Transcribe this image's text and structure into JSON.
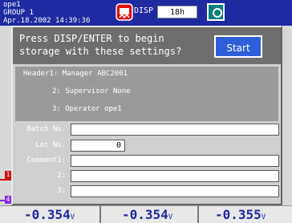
{
  "header": {
    "line1": "ope1",
    "line2": "GROUP 1",
    "line3": "Apr.18.2002 14:39:36",
    "disp_label": "DISP",
    "disp_value": "18h",
    "disp_icon": "disp-icon",
    "media_icon": "media-icon"
  },
  "dialog": {
    "prompt_line1": "Press DISP/ENTER to begin",
    "prompt_line2": "storage with these settings?",
    "start_label": "Start",
    "header1": "Header1: Manager ABC2001",
    "header2": "2: Supervisor None",
    "header3": "3: Operator ope1",
    "fields": {
      "batch_label": "Batch No.",
      "batch_value": "",
      "lot_label": "Lot No.",
      "lot_value": "0",
      "comment1_label": "Comment1:",
      "comment1_value": "",
      "comment2_label": "2:",
      "comment2_value": "",
      "comment3_label": "3:",
      "comment3_value": ""
    }
  },
  "channels": {
    "marker1": "1",
    "marker4": "4"
  },
  "readings": [
    {
      "value": "-0.354",
      "unit": "V"
    },
    {
      "value": "-0.354",
      "unit": "V"
    },
    {
      "value": "-0.355",
      "unit": "V"
    }
  ],
  "colors": {
    "topbar": "#1f2aa0",
    "start_button": "#2f5fd8",
    "channel1": "#d01010",
    "channel4": "#8a2be2"
  }
}
